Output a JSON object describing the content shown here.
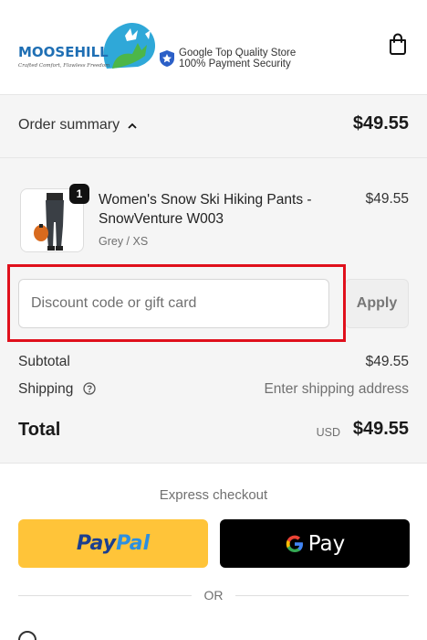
{
  "header": {
    "brand_name": "MOOSEHILL",
    "brand_tagline": "Crafted Comfort, Flawless Freedom",
    "trust_line_1": "Google Top Quality Store",
    "trust_line_2": "100% Payment Security",
    "cart_icon": "shopping-bag-icon"
  },
  "summary": {
    "toggle_label": "Order summary",
    "toggle_icon": "chevron-up-icon",
    "total": "$49.55"
  },
  "product": {
    "name": "Women's Snow Ski Hiking Pants - SnowVenture W003",
    "variant": "Grey / XS",
    "price": "$49.55",
    "quantity": "1"
  },
  "discount": {
    "placeholder": "Discount code or gift card",
    "value": "",
    "apply_label": "Apply"
  },
  "totals": {
    "subtotal_label": "Subtotal",
    "subtotal_value": "$49.55",
    "shipping_label": "Shipping",
    "shipping_value": "Enter shipping address",
    "total_label": "Total",
    "currency": "USD",
    "total_value": "$49.55"
  },
  "express": {
    "title": "Express checkout",
    "paypal_part1": "Pay",
    "paypal_part2": "Pal",
    "gpay_label": "Pay",
    "or_label": "OR"
  },
  "colors": {
    "highlight": "#e0101c",
    "paypal_yellow": "#ffc439",
    "brand_blue": "#1f6fb4"
  }
}
